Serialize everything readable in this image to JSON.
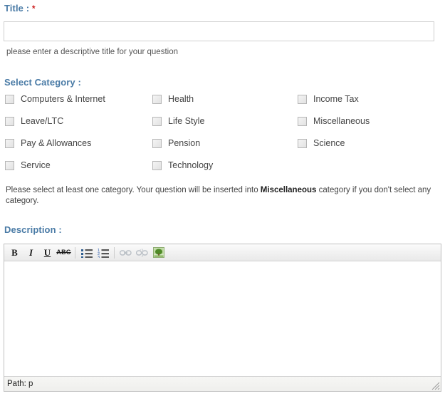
{
  "form": {
    "title_section": {
      "label": "Title :",
      "required_marker": "*",
      "input_value": "",
      "input_placeholder": "",
      "hint": "please enter a descriptive title for your question"
    },
    "category_section": {
      "label": "Select Category :",
      "rows": [
        [
          {
            "label": "Computers & Internet",
            "checked": false
          },
          {
            "label": "Health",
            "checked": false
          },
          {
            "label": "Income Tax",
            "checked": false
          }
        ],
        [
          {
            "label": "Leave/LTC",
            "checked": false
          },
          {
            "label": "Life Style",
            "checked": false
          },
          {
            "label": "Miscellaneous",
            "checked": false
          }
        ],
        [
          {
            "label": "Pay & Allowances",
            "checked": false
          },
          {
            "label": "Pension",
            "checked": false
          },
          {
            "label": "Science",
            "checked": false
          }
        ],
        [
          {
            "label": "Service",
            "checked": false
          },
          {
            "label": "Technology",
            "checked": false
          }
        ]
      ],
      "note_before": "Please select at least one category. Your question will be inserted into ",
      "note_emphasis": "Miscellaneous",
      "note_after": " category if you don't select any category."
    },
    "description_section": {
      "label": "Description :",
      "toolbar": [
        {
          "name": "bold-button",
          "icon": "bold-icon",
          "glyph": "B",
          "title": "Bold",
          "disabled": false
        },
        {
          "name": "italic-button",
          "icon": "italic-icon",
          "glyph": "I",
          "title": "Italic",
          "disabled": false
        },
        {
          "name": "underline-button",
          "icon": "underline-icon",
          "glyph": "U",
          "title": "Underline",
          "disabled": false
        },
        {
          "name": "strikethrough-button",
          "icon": "strikethrough-icon",
          "glyph": "ABC",
          "title": "Strikethrough",
          "disabled": false
        },
        {
          "name": "unordered-list-button",
          "icon": "bullet-list-icon",
          "glyph": "",
          "title": "Unordered list",
          "disabled": false
        },
        {
          "name": "ordered-list-button",
          "icon": "numbered-list-icon",
          "glyph": "",
          "title": "Ordered list",
          "disabled": false
        },
        {
          "name": "insert-link-button",
          "icon": "link-icon",
          "glyph": "",
          "title": "Insert/edit link",
          "disabled": true
        },
        {
          "name": "unlink-button",
          "icon": "unlink-icon",
          "glyph": "",
          "title": "Unlink",
          "disabled": true
        },
        {
          "name": "insert-image-button",
          "icon": "image-icon",
          "glyph": "",
          "title": "Insert/edit image",
          "disabled": false
        }
      ],
      "body_value": "",
      "status_path": "Path: p"
    }
  },
  "colors": {
    "label_blue": "#4a7ba6",
    "required_red": "#cc2222",
    "body_text": "#444444",
    "border_gray": "#c0c0c0",
    "toolbar_bg": "#f2f2f2",
    "image_icon_green": "#6aa832"
  }
}
